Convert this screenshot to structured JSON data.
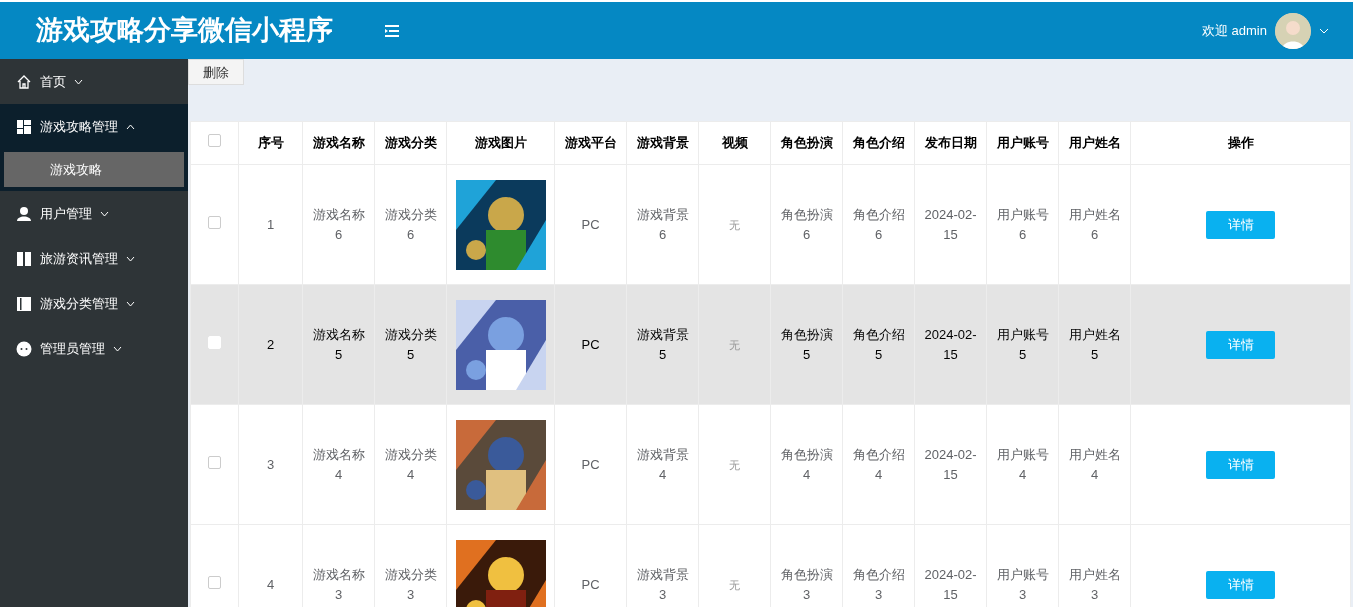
{
  "header": {
    "title": "游戏攻略分享微信小程序",
    "welcome": "欢迎 admin"
  },
  "sidebar": {
    "items": [
      {
        "label": "首页",
        "kind": "home",
        "expanded": false
      },
      {
        "label": "游戏攻略管理",
        "kind": "grid",
        "expanded": true,
        "children": [
          {
            "label": "游戏攻略",
            "selected": true
          }
        ]
      },
      {
        "label": "用户管理",
        "kind": "user",
        "expanded": false
      },
      {
        "label": "旅游资讯管理",
        "kind": "book",
        "expanded": false
      },
      {
        "label": "游戏分类管理",
        "kind": "columns",
        "expanded": false
      },
      {
        "label": "管理员管理",
        "kind": "dots",
        "expanded": false
      }
    ]
  },
  "toolbar": {
    "delete_button": "删除"
  },
  "table": {
    "select_all_checked": false,
    "columns": [
      "序号",
      "游戏名称",
      "游戏分类",
      "游戏图片",
      "游戏平台",
      "游戏背景",
      "视频",
      "角色扮演",
      "角色介绍",
      "发布日期",
      "用户账号",
      "用户姓名",
      "操作"
    ],
    "rows": [
      {
        "checked": false,
        "hovered": false,
        "no": "1",
        "game_name": "游戏名称6",
        "category": "游戏分类6",
        "platform": "PC",
        "background": "游戏背景6",
        "video": "无",
        "role_play": "角色扮演6",
        "role_intro": "角色介绍6",
        "date": "2024-02-15",
        "account": "用户账号6",
        "user_name": "用户姓名6",
        "action": "详情"
      },
      {
        "checked": false,
        "hovered": true,
        "no": "2",
        "game_name": "游戏名称5",
        "category": "游戏分类5",
        "platform": "PC",
        "background": "游戏背景5",
        "video": "无",
        "role_play": "角色扮演5",
        "role_intro": "角色介绍5",
        "date": "2024-02-15",
        "account": "用户账号5",
        "user_name": "用户姓名5",
        "action": "详情"
      },
      {
        "checked": false,
        "hovered": false,
        "no": "3",
        "game_name": "游戏名称4",
        "category": "游戏分类4",
        "platform": "PC",
        "background": "游戏背景4",
        "video": "无",
        "role_play": "角色扮演4",
        "role_intro": "角色介绍4",
        "date": "2024-02-15",
        "account": "用户账号4",
        "user_name": "用户姓名4",
        "action": "详情"
      },
      {
        "checked": false,
        "hovered": false,
        "no": "4",
        "game_name": "游戏名称3",
        "category": "游戏分类3",
        "platform": "PC",
        "background": "游戏背景3",
        "video": "无",
        "role_play": "角色扮演3",
        "role_intro": "角色介绍3",
        "date": "2024-02-15",
        "account": "用户账号3",
        "user_name": "用户姓名3",
        "action": "详情"
      }
    ]
  }
}
